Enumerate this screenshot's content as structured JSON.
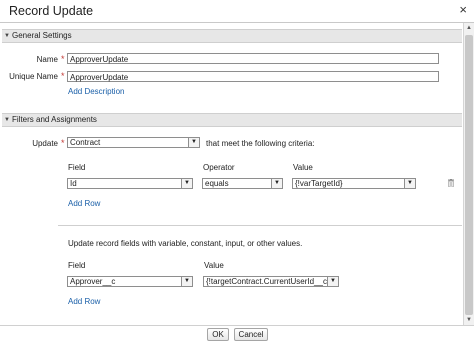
{
  "dialog": {
    "title": "Record Update",
    "close_glyph": "×"
  },
  "general": {
    "header": "General Settings",
    "name_label": "Name",
    "name_value": "ApproverUpdate",
    "unique_label": "Unique Name",
    "unique_value": "ApproverUpdate",
    "add_description": "Add Description"
  },
  "filters": {
    "header": "Filters and Assignments",
    "update_label": "Update",
    "update_value": "Contract",
    "criteria_text": "that meet the following criteria:",
    "col_field": "Field",
    "col_operator": "Operator",
    "col_value": "Value",
    "row": {
      "field": "Id",
      "operator": "equals",
      "value": "{!varTargetId}"
    },
    "add_row": "Add Row"
  },
  "assign": {
    "instructions": "Update record fields with variable, constant, input, or other values.",
    "col_field": "Field",
    "col_value": "Value",
    "row": {
      "field": "Approver__c",
      "value": "{!targetContract.CurrentUserId__c}"
    },
    "add_row": "Add Row"
  },
  "footer": {
    "ok": "OK",
    "cancel": "Cancel"
  },
  "icons": {
    "collapse": "triangle-down-icon",
    "dropdown": "chevron-down-icon",
    "delete": "trash-icon"
  },
  "colors": {
    "required": "#c23934",
    "link": "#1a5fa8",
    "section_bg": "#e7e7e7"
  }
}
